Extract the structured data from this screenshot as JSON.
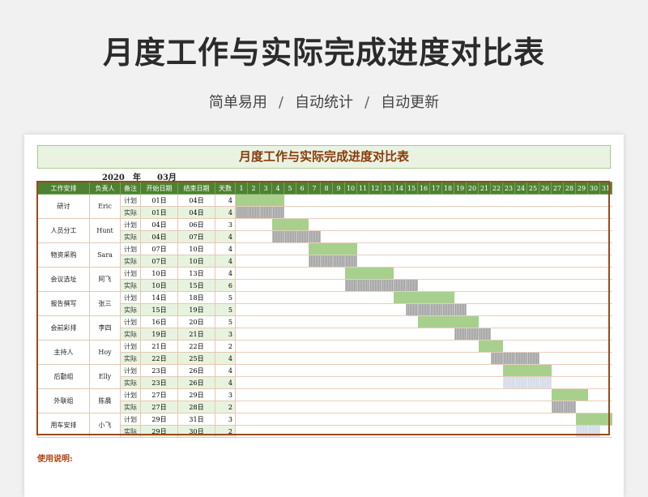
{
  "header": {
    "title": "月度工作与实际完成进度对比表",
    "subtitle_parts": [
      "简单易用",
      "自动统计",
      "自动更新"
    ],
    "separator": "/"
  },
  "sheet": {
    "banner": "月度工作与实际完成进度对比表",
    "year": "2020",
    "year_label": "年",
    "month": "03月",
    "columns": [
      "工作安排",
      "负责人",
      "备注",
      "开始日期",
      "结束日期",
      "天数"
    ],
    "days": [
      "1",
      "2",
      "3",
      "4",
      "5",
      "6",
      "7",
      "8",
      "9",
      "10",
      "11",
      "12",
      "13",
      "14",
      "15",
      "16",
      "17",
      "18",
      "19",
      "20",
      "21",
      "22",
      "23",
      "24",
      "25",
      "26",
      "27",
      "28",
      "29",
      "30",
      "31"
    ],
    "plan_label": "计划",
    "actual_label": "实际",
    "tasks": [
      {
        "task": "研讨",
        "owner": "Eric",
        "plan": {
          "start": "01日",
          "end": "04日",
          "days": "4",
          "s": 1,
          "e": 4
        },
        "actual": {
          "start": "01日",
          "end": "04日",
          "days": "4",
          "s": 1,
          "e": 4
        }
      },
      {
        "task": "人员分工",
        "owner": "Hunt",
        "plan": {
          "start": "04日",
          "end": "06日",
          "days": "3",
          "s": 4,
          "e": 6
        },
        "actual": {
          "start": "04日",
          "end": "07日",
          "days": "4",
          "s": 4,
          "e": 7
        }
      },
      {
        "task": "物资采购",
        "owner": "Sara",
        "plan": {
          "start": "07日",
          "end": "10日",
          "days": "4",
          "s": 7,
          "e": 10
        },
        "actual": {
          "start": "07日",
          "end": "10日",
          "days": "4",
          "s": 7,
          "e": 10
        }
      },
      {
        "task": "会议选址",
        "owner": "阿飞",
        "plan": {
          "start": "10日",
          "end": "13日",
          "days": "4",
          "s": 10,
          "e": 13
        },
        "actual": {
          "start": "10日",
          "end": "15日",
          "days": "6",
          "s": 10,
          "e": 15
        }
      },
      {
        "task": "报告撰写",
        "owner": "张三",
        "plan": {
          "start": "14日",
          "end": "18日",
          "days": "5",
          "s": 14,
          "e": 18
        },
        "actual": {
          "start": "15日",
          "end": "19日",
          "days": "5",
          "s": 15,
          "e": 19
        }
      },
      {
        "task": "会前彩排",
        "owner": "李四",
        "plan": {
          "start": "16日",
          "end": "20日",
          "days": "5",
          "s": 16,
          "e": 20
        },
        "actual": {
          "start": "19日",
          "end": "21日",
          "days": "3",
          "s": 19,
          "e": 21
        }
      },
      {
        "task": "主持人",
        "owner": "Hoy",
        "plan": {
          "start": "21日",
          "end": "22日",
          "days": "2",
          "s": 21,
          "e": 22
        },
        "actual": {
          "start": "22日",
          "end": "25日",
          "days": "4",
          "s": 22,
          "e": 25
        }
      },
      {
        "task": "后勤组",
        "owner": "Elly",
        "plan": {
          "start": "23日",
          "end": "26日",
          "days": "4",
          "s": 23,
          "e": 26
        },
        "actual": {
          "start": "23日",
          "end": "26日",
          "days": "4",
          "s": 23,
          "e": 26
        }
      },
      {
        "task": "外联组",
        "owner": "陈晨",
        "plan": {
          "start": "27日",
          "end": "29日",
          "days": "3",
          "s": 27,
          "e": 29
        },
        "actual": {
          "start": "27日",
          "end": "28日",
          "days": "2",
          "s": 27,
          "e": 28
        }
      },
      {
        "task": "用车安排",
        "owner": "小飞",
        "plan": {
          "start": "29日",
          "end": "31日",
          "days": "3",
          "s": 29,
          "e": 31
        },
        "actual": {
          "start": "29日",
          "end": "30日",
          "days": "2",
          "s": 29,
          "e": 30
        }
      }
    ],
    "note_label": "使用说明:",
    "colors": {
      "header_green": "#4e8232",
      "plan_bar": "#a8d08d",
      "actual_bar": "#8c8c8c",
      "frame": "#9a4a1e",
      "title_text": "#8a3a0c"
    }
  }
}
